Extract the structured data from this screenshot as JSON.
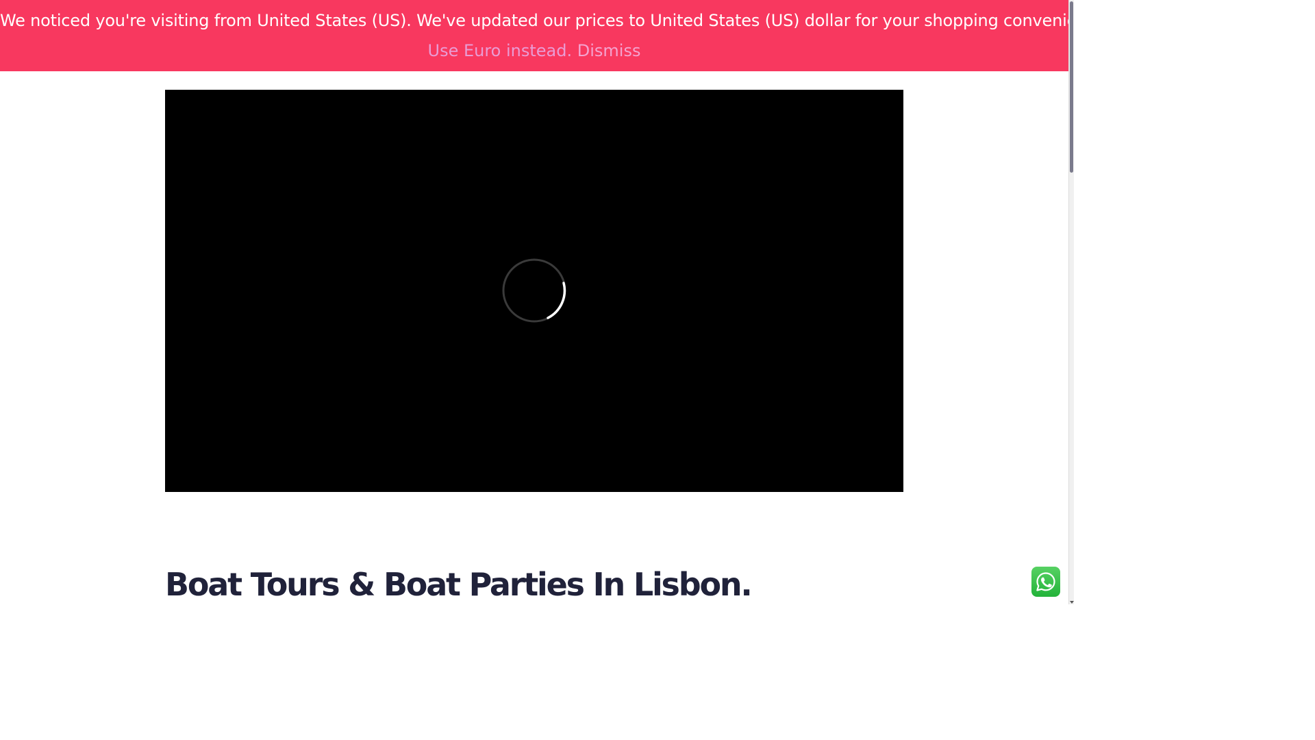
{
  "notice": {
    "message": "We noticed you're visiting from United States (US). We've updated our prices to United States (US) dollar for your shopping convenience.",
    "euro_link": "Use Euro instead.",
    "dismiss_link": "Dismiss",
    "background_color": "#f8385f"
  },
  "video": {
    "state": "loading",
    "spinner_icon": "loading-spinner-icon"
  },
  "hero": {
    "title": "Boat Tours & Boat Parties In Lisbon."
  },
  "floating": {
    "whatsapp_icon": "whatsapp-icon"
  },
  "colors": {
    "title": "#20223a",
    "whatsapp": "#25d366"
  }
}
